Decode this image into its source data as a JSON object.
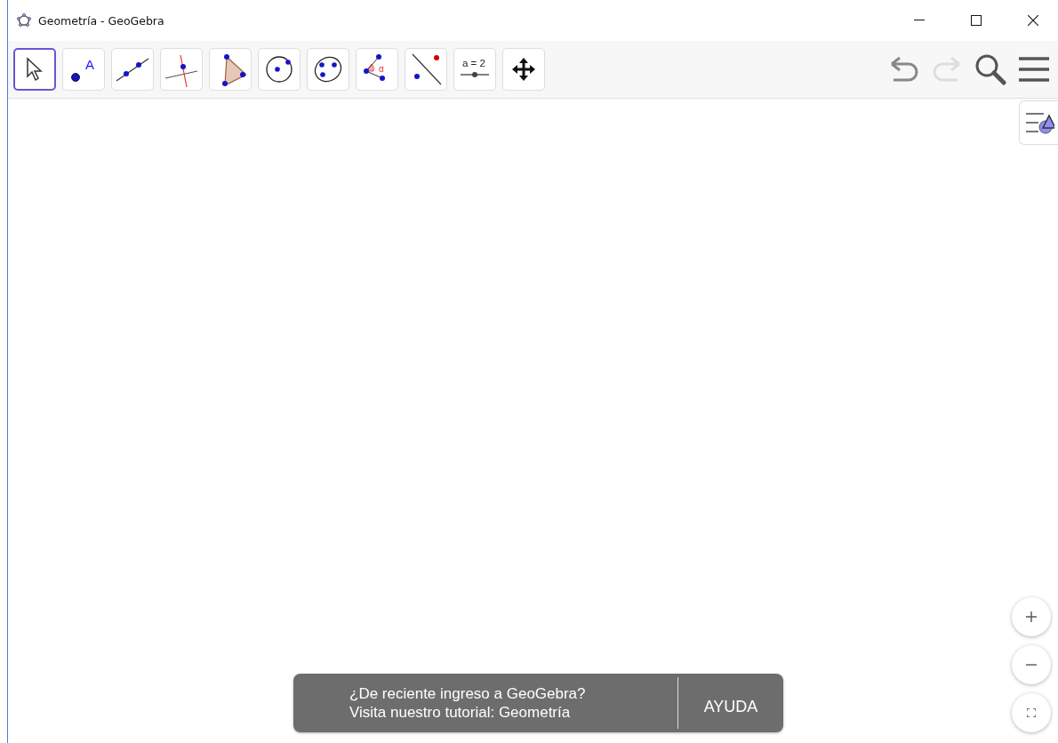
{
  "window": {
    "title": "Geometría - GeoGebra"
  },
  "tools": [
    {
      "kind": "move",
      "selected": true
    },
    {
      "kind": "point",
      "label": "A",
      "selected": false
    },
    {
      "kind": "line",
      "selected": false
    },
    {
      "kind": "perpendicular",
      "selected": false
    },
    {
      "kind": "polygon",
      "selected": false
    },
    {
      "kind": "circle",
      "selected": false
    },
    {
      "kind": "conic",
      "selected": false
    },
    {
      "kind": "angle",
      "label": "α",
      "selected": false
    },
    {
      "kind": "reflect",
      "selected": false
    },
    {
      "kind": "slider",
      "label": "a = 2",
      "selected": false
    },
    {
      "kind": "pan",
      "selected": false
    }
  ],
  "undo": {
    "disabled": false
  },
  "redo": {
    "disabled": true
  },
  "toast": {
    "lines": [
      "¿De reciente ingreso a GeoGebra?",
      "Visita nuestro tutorial: Geometría"
    ],
    "button": "AYUDA"
  }
}
